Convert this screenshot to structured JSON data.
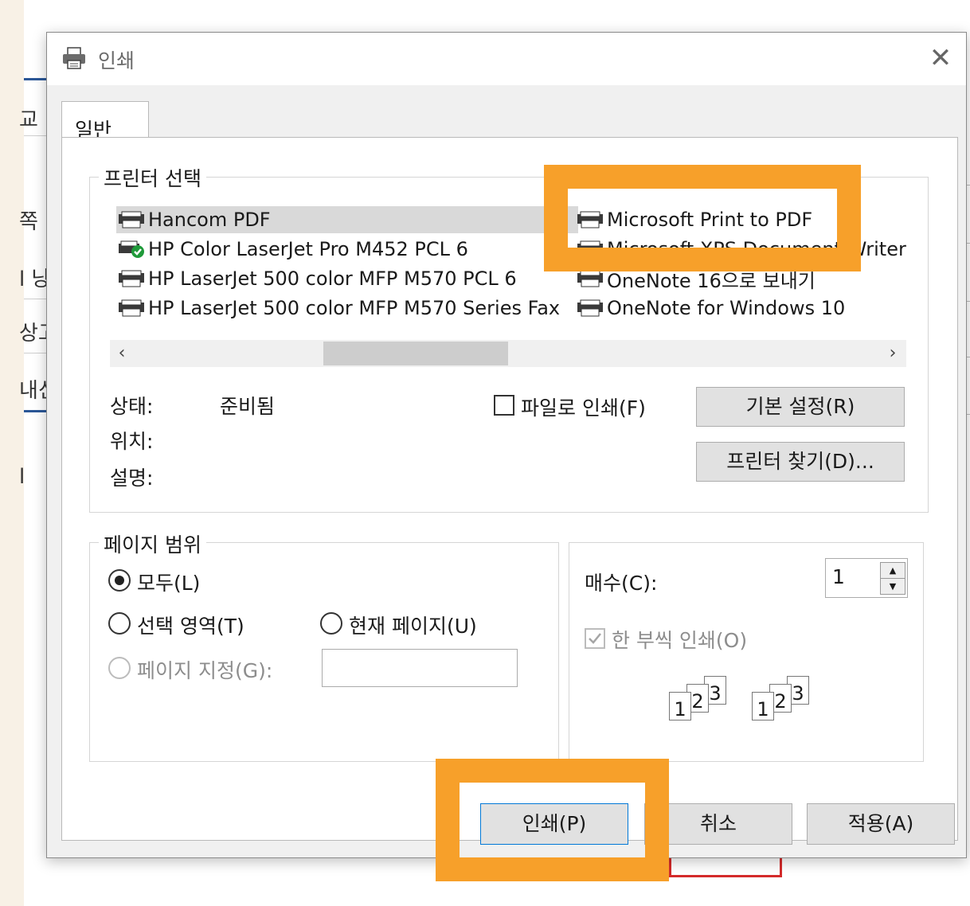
{
  "background": {
    "fragments": [
      "교",
      "쪽",
      "l 낭",
      "상고",
      "내신",
      "l"
    ]
  },
  "dialog": {
    "title": "인쇄",
    "close_label": "✕",
    "tab_general": "일반",
    "printer_group": {
      "legend": "프린터 선택",
      "printers_col1": [
        "Hancom PDF",
        "HP Color LaserJet Pro M452 PCL 6",
        "HP LaserJet 500 color MFP M570 PCL 6",
        "HP LaserJet 500 color MFP M570 Series Fax"
      ],
      "printers_col2": [
        "Microsoft Print to PDF",
        "Microsoft XPS Document Writer",
        "OneNote 16으로 보내기",
        "OneNote for Windows 10"
      ],
      "status_label": "상태:",
      "status_value": "준비됨",
      "location_label": "위치:",
      "comment_label": "설명:",
      "print_to_file_label": "파일로 인쇄(F)",
      "preferences_button": "기본 설정(R)",
      "find_printer_button": "프린터 찾기(D)..."
    },
    "page_range": {
      "legend": "페이지 범위",
      "all_label": "모두(L)",
      "selection_label": "선택 영역(T)",
      "current_page_label": "현재 페이지(U)",
      "pages_label": "페이지 지정(G):",
      "pages_value": ""
    },
    "copies": {
      "label": "매수(C):",
      "value": "1",
      "collate_label": "한 부씩 인쇄(O)",
      "collate_pages": [
        "1",
        "2",
        "3"
      ]
    },
    "buttons": {
      "print": "인쇄(P)",
      "cancel": "취소",
      "apply": "적용(A)"
    }
  },
  "colors": {
    "highlight": "#f7a02a",
    "accent_blue": "#2b5797"
  }
}
